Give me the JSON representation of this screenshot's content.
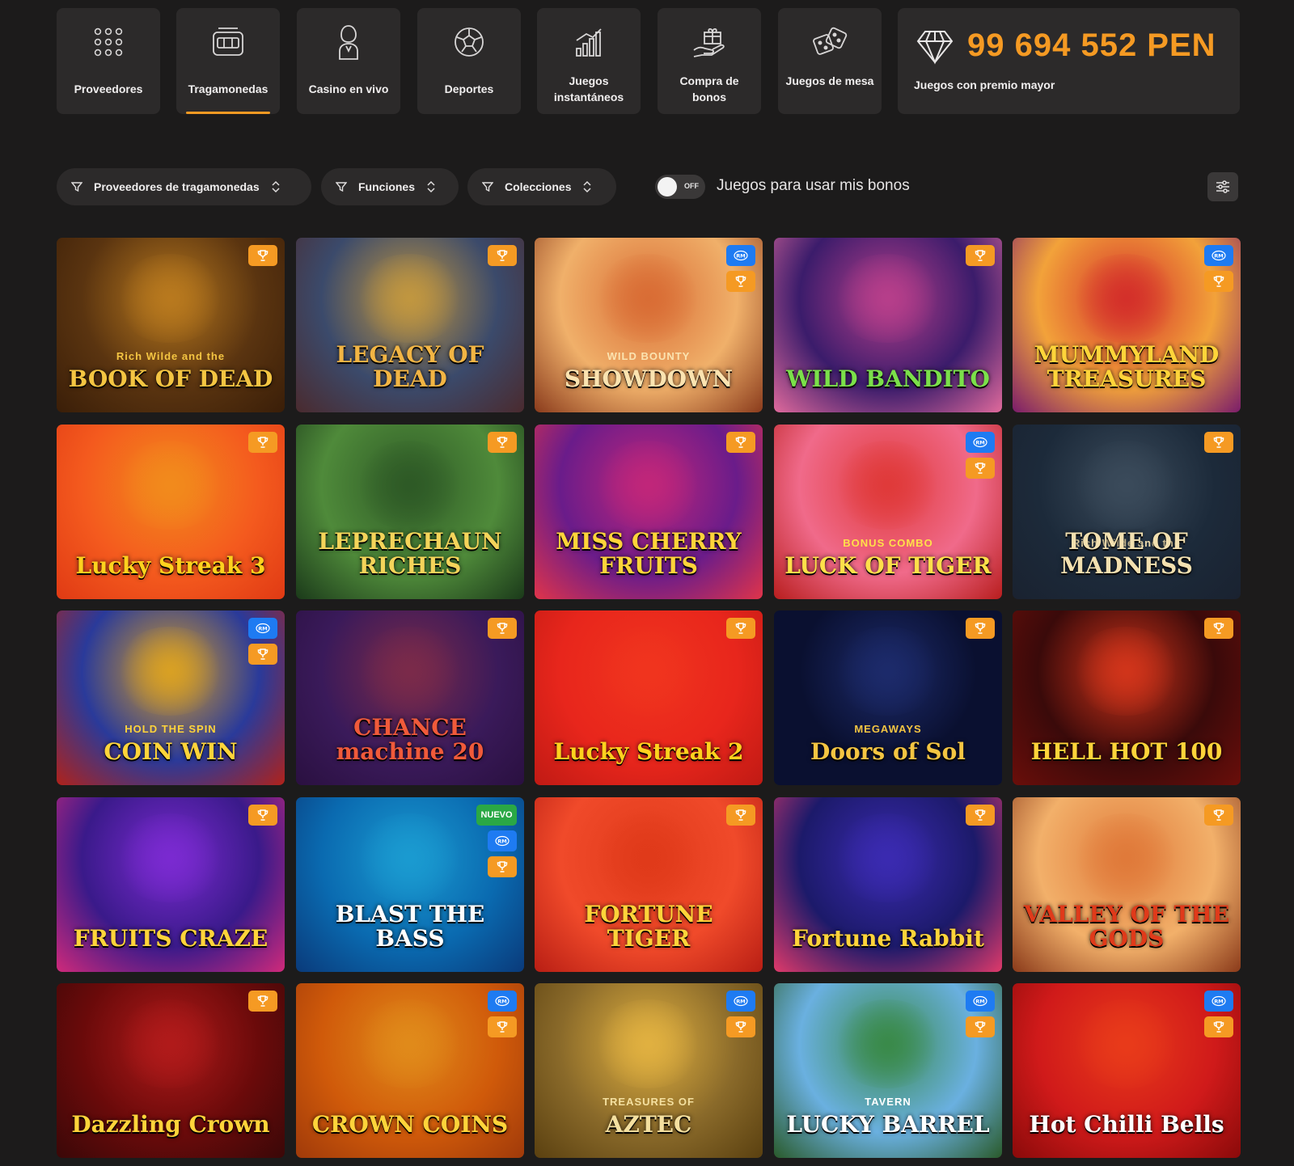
{
  "categories": [
    {
      "label": "Proveedores",
      "icon": "grid-dots-icon",
      "active": false
    },
    {
      "label": "Tragamonedas",
      "icon": "slot-machine-icon",
      "active": true
    },
    {
      "label": "Casino en vivo",
      "icon": "dealer-icon",
      "active": false
    },
    {
      "label": "Deportes",
      "icon": "soccer-ball-icon",
      "active": false
    },
    {
      "label": "Juegos instantáneos",
      "icon": "chart-bars-icon",
      "active": false
    },
    {
      "label": "Compra de bonos",
      "icon": "gift-hand-icon",
      "active": false
    },
    {
      "label": "Juegos de mesa",
      "icon": "dice-icon",
      "active": false
    }
  ],
  "jackpot": {
    "amount": "99 694 552 PEN",
    "label": "Juegos con premio mayor",
    "icon": "diamond-icon"
  },
  "filters": [
    {
      "label": "Proveedores de tragamonedas"
    },
    {
      "label": "Funciones"
    },
    {
      "label": "Colecciones"
    }
  ],
  "bonus_toggle": {
    "state": "OFF",
    "label": "Juegos para usar mis bonos"
  },
  "colors": {
    "accent": "#f59a23",
    "rm_badge": "#1e7bf2",
    "new_badge": "#2aa845",
    "tile_bg": "#2c2a2a",
    "page_bg": "#1c1b1b"
  },
  "games": [
    {
      "title": "BOOK OF DEAD",
      "subtitle": "Rich Wilde and the",
      "badges": [
        "trophy"
      ],
      "bg": [
        "#5a3410",
        "#b8791e",
        "#3a1e08"
      ],
      "color": "#f4c542"
    },
    {
      "title": "LEGACY OF DEAD",
      "subtitle": "",
      "badges": [
        "trophy"
      ],
      "bg": [
        "#3b4a6b",
        "#c09640",
        "#4a2a2e"
      ],
      "color": "#f2b544"
    },
    {
      "title": "SHOWDOWN",
      "subtitle": "WILD BOUNTY",
      "badges": [
        "rm",
        "trophy"
      ],
      "bg": [
        "#f0b06a",
        "#d96d35",
        "#8a3b1c"
      ],
      "color": "#fbe3b0"
    },
    {
      "title": "WILD BANDITO",
      "subtitle": "",
      "badges": [
        "trophy"
      ],
      "bg": [
        "#3b1c6b",
        "#b63e8a",
        "#e06a9c"
      ],
      "color": "#7be04a"
    },
    {
      "title": "MUMMYLAND TREASURES",
      "subtitle": "",
      "badges": [
        "rm",
        "trophy"
      ],
      "bg": [
        "#f2a23a",
        "#d4302a",
        "#7a1c6b"
      ],
      "color": "#ffd43a"
    },
    {
      "title": "Lucky Streak 3",
      "subtitle": "",
      "badges": [
        "trophy"
      ],
      "bg": [
        "#f45a1e",
        "#f28a1c",
        "#e03a14"
      ],
      "color": "#ffd21e"
    },
    {
      "title": "LEPRECHAUN RICHES",
      "subtitle": "",
      "badges": [
        "trophy"
      ],
      "bg": [
        "#4f8a3a",
        "#2e5a26",
        "#1b3a1a"
      ],
      "color": "#f4d45a"
    },
    {
      "title": "MISS CHERRY FRUITS",
      "subtitle": "",
      "badges": [
        "trophy"
      ],
      "bg": [
        "#6a1c8a",
        "#c0267a",
        "#e0344a"
      ],
      "color": "#ffd43a"
    },
    {
      "title": "LUCK OF TIGER",
      "subtitle": "BONUS COMBO",
      "badges": [
        "rm",
        "trophy"
      ],
      "bg": [
        "#f06a8a",
        "#e03a3a",
        "#b81e1e"
      ],
      "color": "#ffe04a"
    },
    {
      "title": "TOME OF MADNESS",
      "subtitle": "Rich Wilde and the",
      "badges": [
        "trophy"
      ],
      "bg": [
        "#1c2a3a",
        "#3a4a5a",
        "#1a2230"
      ],
      "color": "#f2e0b0"
    },
    {
      "title": "COIN WIN",
      "subtitle": "HOLD THE SPIN",
      "badges": [
        "rm",
        "trophy"
      ],
      "bg": [
        "#2a3a9a",
        "#d8a024",
        "#b0221a"
      ],
      "color": "#ffd43a"
    },
    {
      "title": "CHANCE machine 20",
      "subtitle": "",
      "badges": [
        "trophy"
      ],
      "bg": [
        "#3a1a5a",
        "#7a2a4a",
        "#2a1040"
      ],
      "color": "#f05a3a"
    },
    {
      "title": "Lucky Streak 2",
      "subtitle": "",
      "badges": [
        "trophy"
      ],
      "bg": [
        "#e8261c",
        "#f0341e",
        "#c01a14"
      ],
      "color": "#ffd21e"
    },
    {
      "title": "Doors of Sol",
      "subtitle": "MEGAWAYS",
      "badges": [
        "trophy"
      ],
      "bg": [
        "#0a1030",
        "#1c2a6a",
        "#0a1030"
      ],
      "color": "#f4c542"
    },
    {
      "title": "HELL HOT 100",
      "subtitle": "",
      "badges": [
        "trophy"
      ],
      "bg": [
        "#3a0a0a",
        "#d0341a",
        "#6a0e0a"
      ],
      "color": "#ffd43a"
    },
    {
      "title": "FRUITS CRAZE",
      "subtitle": "",
      "badges": [
        "trophy"
      ],
      "bg": [
        "#3a1a8a",
        "#7a2ad0",
        "#d02a7a"
      ],
      "color": "#ffd43a"
    },
    {
      "title": "BLAST THE BASS",
      "subtitle": "",
      "badges": [
        "nuevo",
        "rm",
        "trophy"
      ],
      "bg": [
        "#0a6ab0",
        "#1a9ad0",
        "#0a3a7a"
      ],
      "color": "#ffffff"
    },
    {
      "title": "FORTUNE TIGER",
      "subtitle": "",
      "badges": [
        "trophy"
      ],
      "bg": [
        "#f04a2a",
        "#e03a1a",
        "#b81e14"
      ],
      "color": "#ffd43a"
    },
    {
      "title": "Fortune Rabbit",
      "subtitle": "",
      "badges": [
        "trophy"
      ],
      "bg": [
        "#1c1a6a",
        "#3a2ab0",
        "#e03a6a"
      ],
      "color": "#ffd43a"
    },
    {
      "title": "VALLEY OF THE GODS",
      "subtitle": "",
      "badges": [
        "trophy"
      ],
      "bg": [
        "#f2b06a",
        "#e07a3a",
        "#8a3a1a"
      ],
      "color": "#e03a1a"
    },
    {
      "title": "Dazzling Crown",
      "subtitle": "",
      "badges": [
        "trophy"
      ],
      "bg": [
        "#6a0a0a",
        "#b01a1a",
        "#3a0808"
      ],
      "color": "#ffd43a"
    },
    {
      "title": "CROWN COINS",
      "subtitle": "",
      "badges": [
        "rm",
        "trophy"
      ],
      "bg": [
        "#d05a0a",
        "#e08a1a",
        "#a03a0a"
      ],
      "color": "#ffd43a"
    },
    {
      "title": "AZTEC",
      "subtitle": "TREASURES OF",
      "badges": [
        "rm",
        "trophy"
      ],
      "bg": [
        "#8a6a2a",
        "#e0b040",
        "#5a4010"
      ],
      "color": "#f4e0a0"
    },
    {
      "title": "LUCKY BARREL",
      "subtitle": "TAVERN",
      "badges": [
        "rm",
        "trophy"
      ],
      "bg": [
        "#6ab0e0",
        "#3a8a4a",
        "#2a5a2a"
      ],
      "color": "#ffffff"
    },
    {
      "title": "Hot Chilli Bells",
      "subtitle": "",
      "badges": [
        "rm",
        "trophy"
      ],
      "bg": [
        "#d01a1a",
        "#e83a1a",
        "#8a0a0a"
      ],
      "color": "#ffffff"
    }
  ]
}
